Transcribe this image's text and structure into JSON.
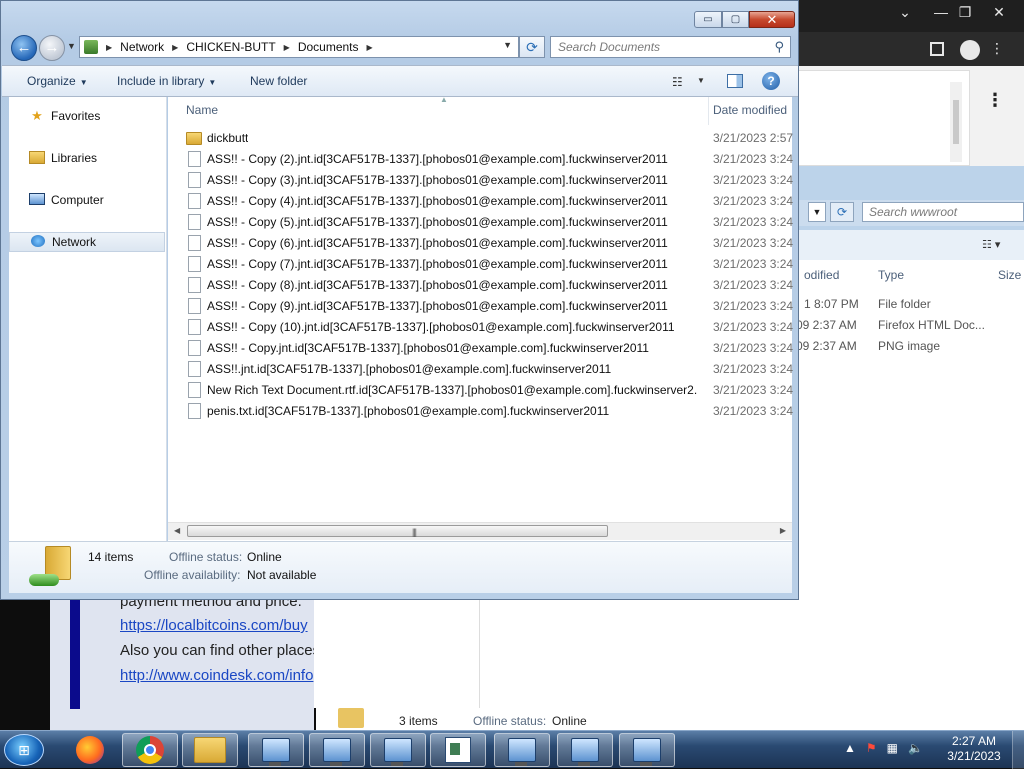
{
  "window": {
    "breadcrumb": [
      "Network",
      "CHICKEN-BUTT",
      "Documents"
    ],
    "search_placeholder": "Search Documents",
    "toolbar": {
      "organize": "Organize",
      "include_in_library": "Include in library",
      "new_folder": "New folder"
    },
    "caption": {
      "minimize": "▭",
      "maximize": "▢",
      "close": "✕"
    }
  },
  "nav_pane": {
    "items": [
      {
        "label": "Favorites",
        "icon": "star-icon"
      },
      {
        "label": "Libraries",
        "icon": "libraries-icon"
      },
      {
        "label": "Computer",
        "icon": "computer-icon"
      },
      {
        "label": "Network",
        "icon": "network-icon",
        "selected": true
      }
    ]
  },
  "columns": {
    "name": "Name",
    "date_modified": "Date modified"
  },
  "files": [
    {
      "name": "dickbutt",
      "date": "3/21/2023 2:57",
      "type": "folder"
    },
    {
      "name": "ASS!! - Copy (2).jnt.id[3CAF517B-1337].[phobos01@example.com].fuckwinserver2011",
      "date": "3/21/2023 3:24",
      "type": "file"
    },
    {
      "name": "ASS!! - Copy (3).jnt.id[3CAF517B-1337].[phobos01@example.com].fuckwinserver2011",
      "date": "3/21/2023 3:24",
      "type": "file"
    },
    {
      "name": "ASS!! - Copy (4).jnt.id[3CAF517B-1337].[phobos01@example.com].fuckwinserver2011",
      "date": "3/21/2023 3:24",
      "type": "file"
    },
    {
      "name": "ASS!! - Copy (5).jnt.id[3CAF517B-1337].[phobos01@example.com].fuckwinserver2011",
      "date": "3/21/2023 3:24",
      "type": "file"
    },
    {
      "name": "ASS!! - Copy (6).jnt.id[3CAF517B-1337].[phobos01@example.com].fuckwinserver2011",
      "date": "3/21/2023 3:24",
      "type": "file"
    },
    {
      "name": "ASS!! - Copy (7).jnt.id[3CAF517B-1337].[phobos01@example.com].fuckwinserver2011",
      "date": "3/21/2023 3:24",
      "type": "file"
    },
    {
      "name": "ASS!! - Copy (8).jnt.id[3CAF517B-1337].[phobos01@example.com].fuckwinserver2011",
      "date": "3/21/2023 3:24",
      "type": "file"
    },
    {
      "name": "ASS!! - Copy (9).jnt.id[3CAF517B-1337].[phobos01@example.com].fuckwinserver2011",
      "date": "3/21/2023 3:24",
      "type": "file"
    },
    {
      "name": "ASS!! - Copy (10).jnt.id[3CAF517B-1337].[phobos01@example.com].fuckwinserver2011",
      "date": "3/21/2023 3:24",
      "type": "file"
    },
    {
      "name": "ASS!! - Copy.jnt.id[3CAF517B-1337].[phobos01@example.com].fuckwinserver2011",
      "date": "3/21/2023 3:24",
      "type": "file"
    },
    {
      "name": "ASS!!.jnt.id[3CAF517B-1337].[phobos01@example.com].fuckwinserver2011",
      "date": "3/21/2023 3:24",
      "type": "file"
    },
    {
      "name": "New Rich Text Document.rtf.id[3CAF517B-1337].[phobos01@example.com].fuckwinserver2...",
      "date": "3/21/2023 3:24",
      "type": "file"
    },
    {
      "name": "penis.txt.id[3CAF517B-1337].[phobos01@example.com].fuckwinserver2011",
      "date": "3/21/2023 3:24",
      "type": "file"
    }
  ],
  "details": {
    "count": "14 items",
    "offline_status_label": "Offline status:",
    "offline_status_value": "Online",
    "offline_availability_label": "Offline availability:",
    "offline_availability_value": "Not available"
  },
  "bg_explorer": {
    "search_placeholder": "Search wwwroot",
    "headers": {
      "modified": "odified",
      "type": "Type",
      "size": "Size"
    },
    "rows": [
      {
        "modified": "1 8:07 PM",
        "type": "File folder"
      },
      {
        "modified": "09 2:37 AM",
        "type": "Firefox HTML Doc..."
      },
      {
        "modified": "09 2:37 AM",
        "type": "PNG image"
      }
    ],
    "status": {
      "count": "3 items",
      "offline_label": "Offline status:",
      "offline_value": "Online"
    }
  },
  "bg_browser": {
    "line1": "payment method and price.",
    "link1": "https://localbitcoins.com/buy",
    "line2": "Also you can find other places",
    "link2": "http://www.coindesk.com/info"
  },
  "taskbar": {
    "clock_time": "2:27 AM",
    "clock_date": "3/21/2023"
  }
}
